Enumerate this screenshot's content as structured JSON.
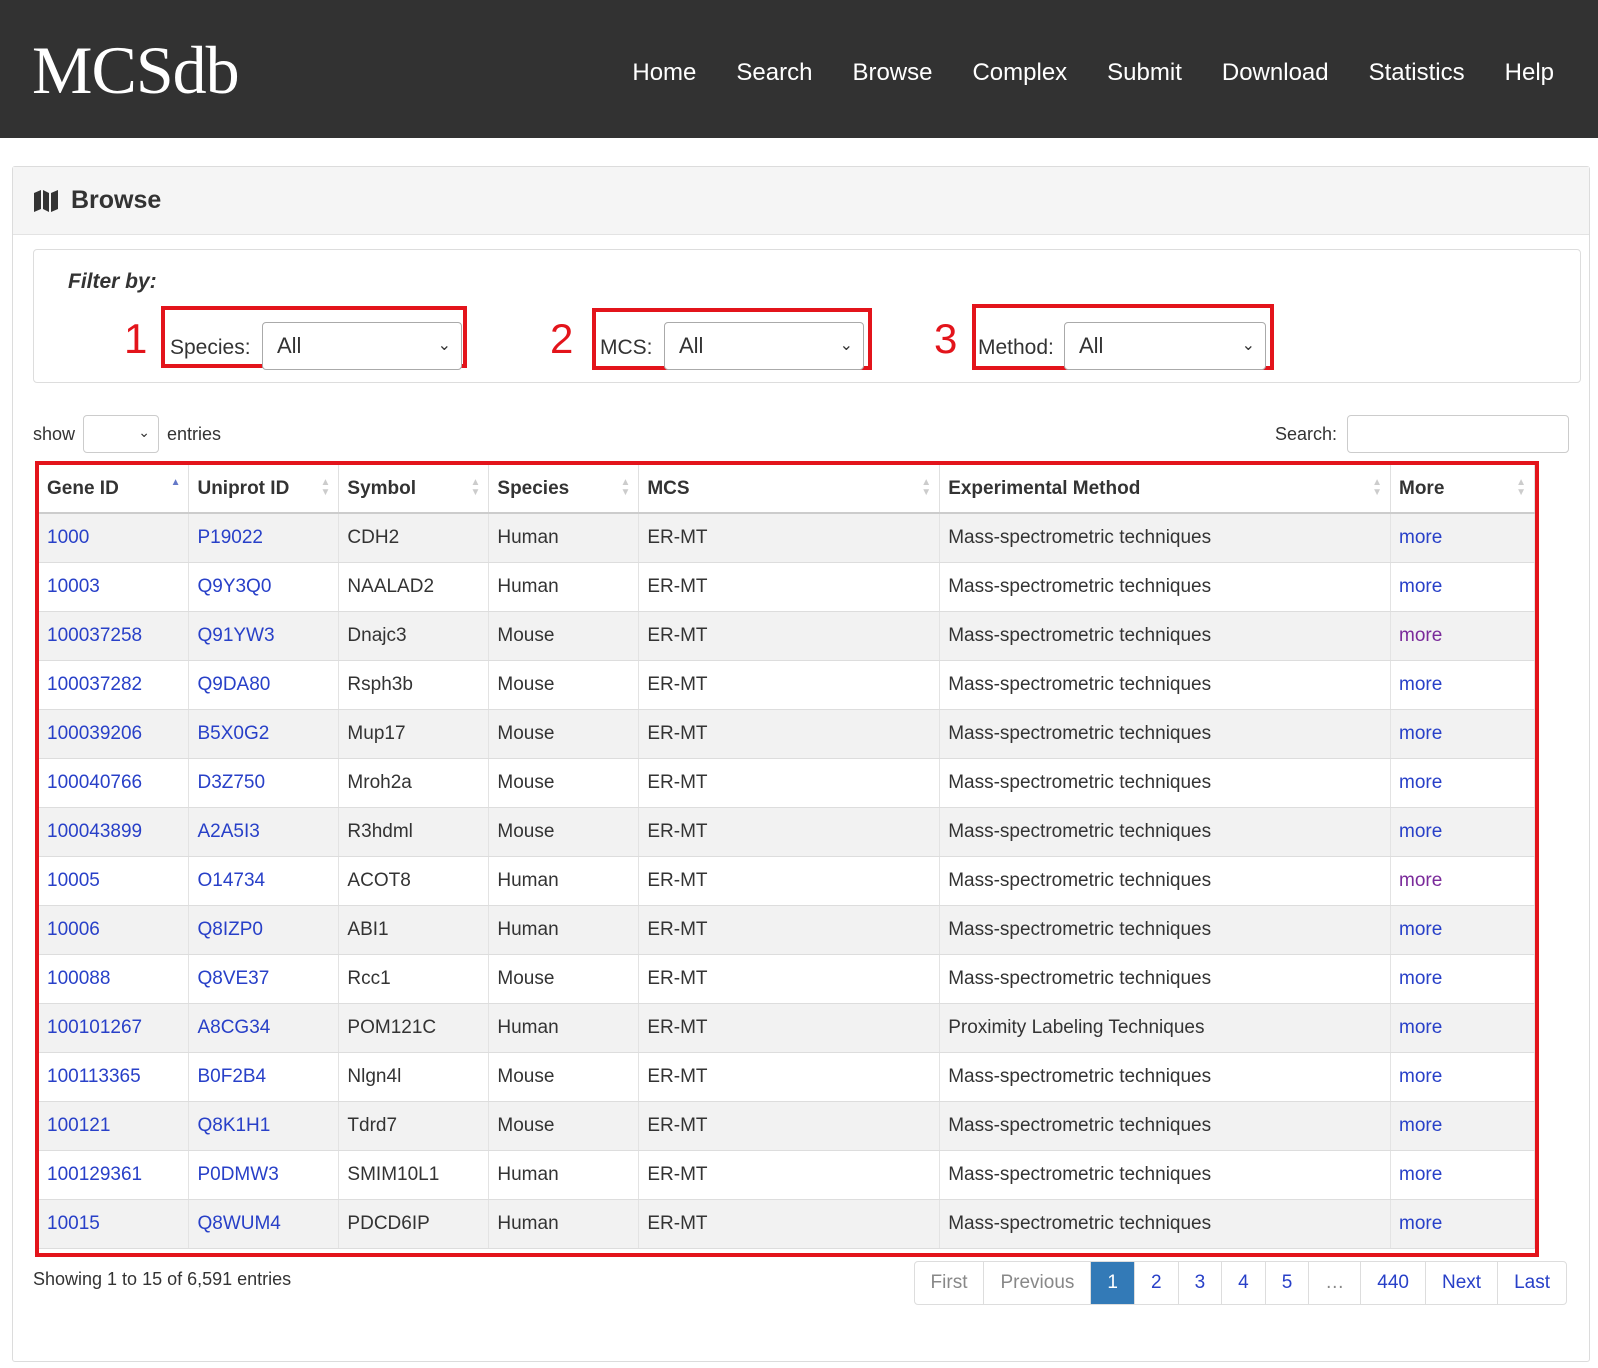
{
  "brand": "MCSdb",
  "nav": [
    "Home",
    "Search",
    "Browse",
    "Complex",
    "Submit",
    "Download",
    "Statistics",
    "Help"
  ],
  "panel": {
    "title": "Browse"
  },
  "filters": {
    "title": "Filter by:",
    "species": {
      "num": "1",
      "label": "Species:",
      "value": "All"
    },
    "mcs": {
      "num": "2",
      "label": "MCS:",
      "value": "All"
    },
    "method": {
      "num": "3",
      "label": "Method:",
      "value": "All"
    }
  },
  "length": {
    "show": "show",
    "entries": "entries",
    "value": ""
  },
  "search": {
    "label": "Search:",
    "value": ""
  },
  "table": {
    "headers": [
      "Gene ID",
      "Uniprot ID",
      "Symbol",
      "Species",
      "MCS",
      "Experimental Method",
      "More"
    ],
    "rows": [
      [
        "1000",
        "P19022",
        "CDH2",
        "Human",
        "ER-MT",
        "Mass-spectrometric techniques",
        "more"
      ],
      [
        "10003",
        "Q9Y3Q0",
        "NAALAD2",
        "Human",
        "ER-MT",
        "Mass-spectrometric techniques",
        "more"
      ],
      [
        "100037258",
        "Q91YW3",
        "Dnajc3",
        "Mouse",
        "ER-MT",
        "Mass-spectrometric techniques",
        "more"
      ],
      [
        "100037282",
        "Q9DA80",
        "Rsph3b",
        "Mouse",
        "ER-MT",
        "Mass-spectrometric techniques",
        "more"
      ],
      [
        "100039206",
        "B5X0G2",
        "Mup17",
        "Mouse",
        "ER-MT",
        "Mass-spectrometric techniques",
        "more"
      ],
      [
        "100040766",
        "D3Z750",
        "Mroh2a",
        "Mouse",
        "ER-MT",
        "Mass-spectrometric techniques",
        "more"
      ],
      [
        "100043899",
        "A2A5I3",
        "R3hdml",
        "Mouse",
        "ER-MT",
        "Mass-spectrometric techniques",
        "more"
      ],
      [
        "10005",
        "O14734",
        "ACOT8",
        "Human",
        "ER-MT",
        "Mass-spectrometric techniques",
        "more"
      ],
      [
        "10006",
        "Q8IZP0",
        "ABI1",
        "Human",
        "ER-MT",
        "Mass-spectrometric techniques",
        "more"
      ],
      [
        "100088",
        "Q8VE37",
        "Rcc1",
        "Mouse",
        "ER-MT",
        "Mass-spectrometric techniques",
        "more"
      ],
      [
        "100101267",
        "A8CG34",
        "POM121C",
        "Human",
        "ER-MT",
        "Proximity Labeling Techniques",
        "more"
      ],
      [
        "100113365",
        "B0F2B4",
        "Nlgn4l",
        "Mouse",
        "ER-MT",
        "Mass-spectrometric techniques",
        "more"
      ],
      [
        "100121",
        "Q8K1H1",
        "Tdrd7",
        "Mouse",
        "ER-MT",
        "Mass-spectrometric techniques",
        "more"
      ],
      [
        "100129361",
        "P0DMW3",
        "SMIM10L1",
        "Human",
        "ER-MT",
        "Mass-spectrometric techniques",
        "more"
      ],
      [
        "10015",
        "Q8WUM4",
        "PDCD6IP",
        "Human",
        "ER-MT",
        "Mass-spectrometric techniques",
        "more"
      ]
    ],
    "visited_more_rows": [
      2,
      7
    ]
  },
  "info": "Showing 1 to 15 of 6,591 entries",
  "pagination": [
    "First",
    "Previous",
    "1",
    "2",
    "3",
    "4",
    "5",
    "…",
    "440",
    "Next",
    "Last"
  ],
  "pagination_current": "1",
  "colors": {
    "navbar": "#323232",
    "highlight": "#e3141b",
    "link": "#2840c8",
    "visited": "#7a2a9a",
    "active_page": "#337ab7"
  }
}
